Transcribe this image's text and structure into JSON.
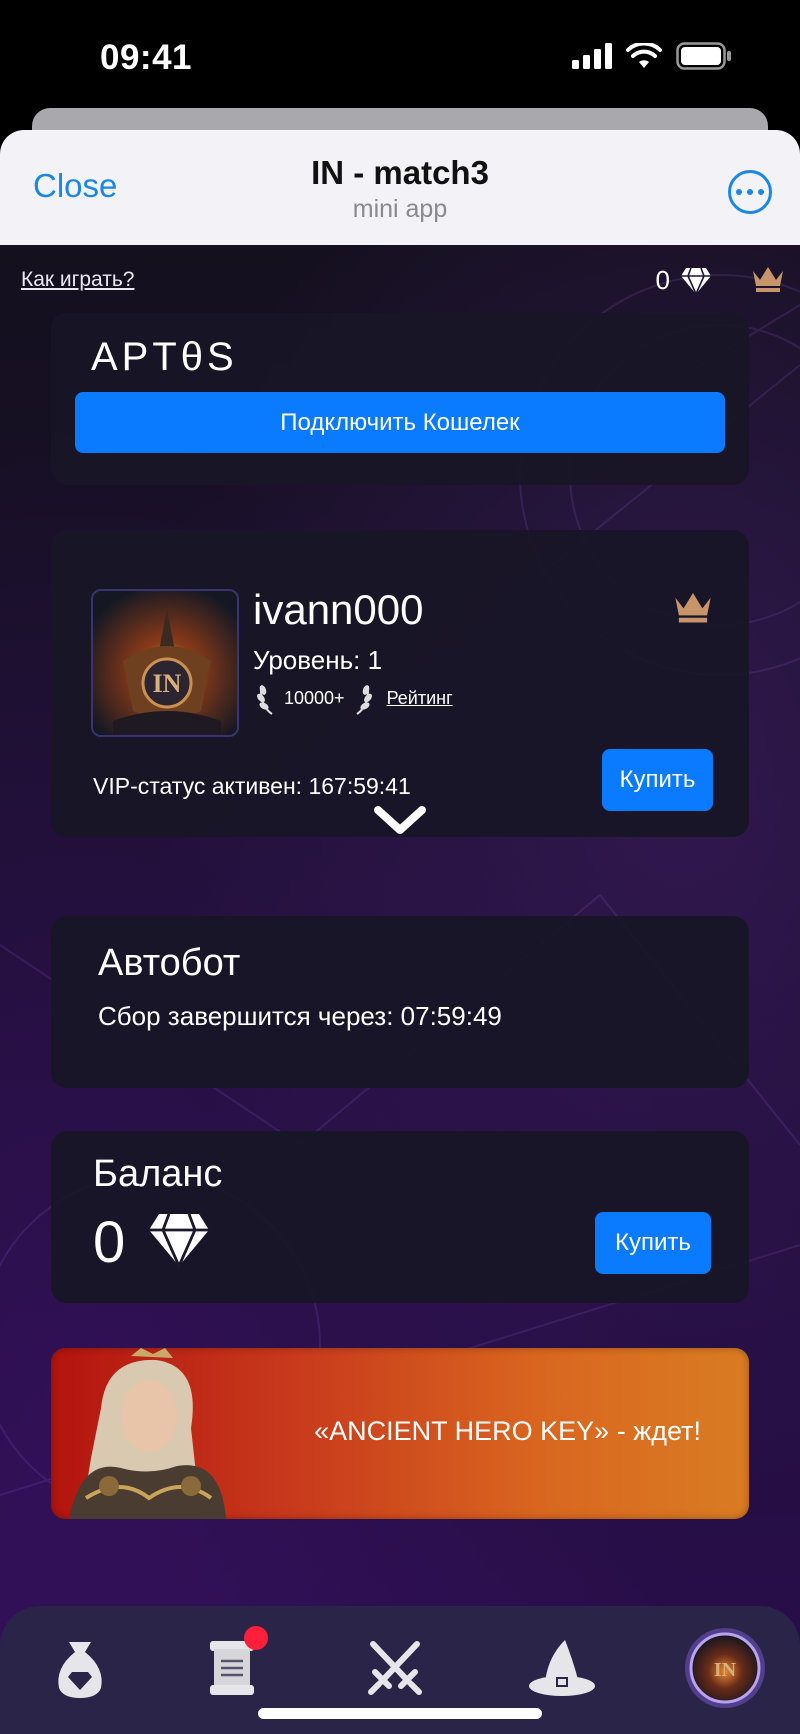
{
  "status_bar": {
    "time": "09:41"
  },
  "header": {
    "close_label": "Close",
    "title": "IN - match3",
    "subtitle": "mini app"
  },
  "top_bar": {
    "howto_label": "Как играть?",
    "gem_count": "0"
  },
  "wallet_card": {
    "brand": "APTθS",
    "connect_label": "Подключить Кошелек"
  },
  "profile_card": {
    "username": "ivann000",
    "level": "Уровень: 1",
    "rank": "10000+",
    "rating_label": "Рейтинг",
    "vip_status": "VIP-статус активен: 167:59:41",
    "buy_label": "Купить"
  },
  "autobot_card": {
    "title": "Автобот",
    "status": "Сбор завершится через: 07:59:49"
  },
  "balance_card": {
    "title": "Баланс",
    "value": "0",
    "buy_label": "Купить"
  },
  "promo": {
    "text": "«ANCIENT HERO KEY» - ждет!"
  },
  "bottom_nav": {
    "items": [
      "shop-bag",
      "tasks-scroll",
      "battle-swords",
      "wizard-hat",
      "profile-avatar"
    ]
  },
  "colors": {
    "accent": "#0a7aff",
    "header_link": "#1a87e6",
    "crown": "#c8956a",
    "badge": "#ff1f3a"
  }
}
